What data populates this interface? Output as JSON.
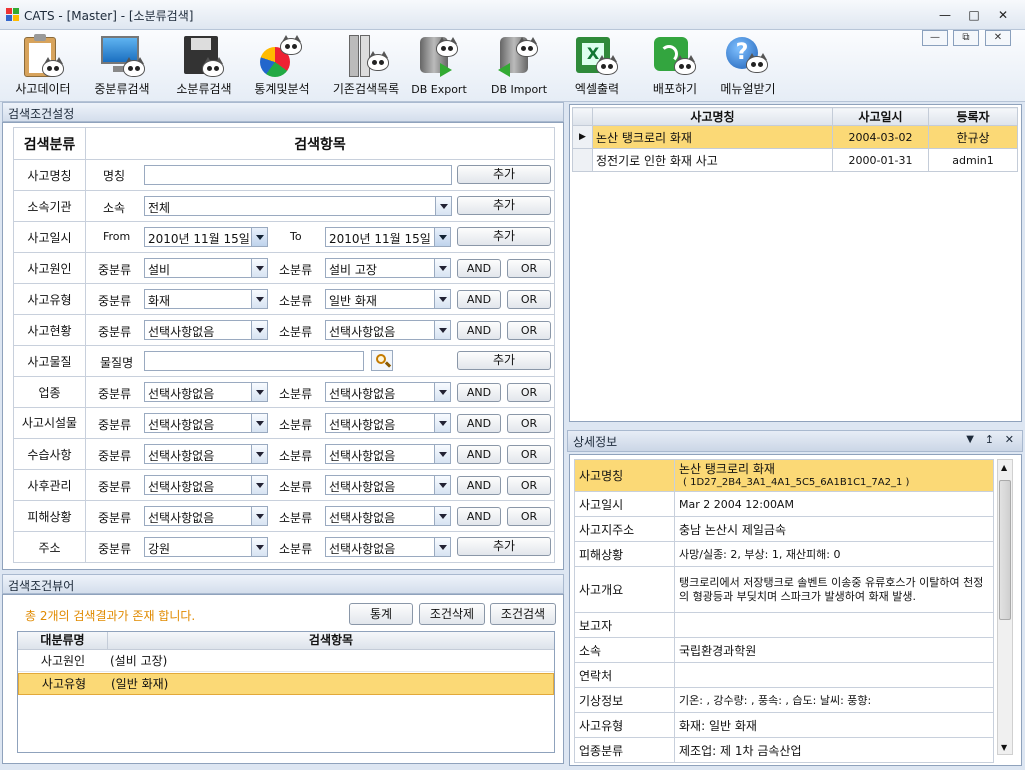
{
  "window": {
    "title": "CATS - [Master] - [소분류검색]"
  },
  "toolbar": [
    {
      "label": "사고데이터",
      "icon": "clipboard-icon"
    },
    {
      "label": "중분류검색",
      "icon": "monitor-icon"
    },
    {
      "label": "소분류검색",
      "icon": "disk-icon"
    },
    {
      "label": "통계및분석",
      "icon": "pie-chart-icon"
    },
    {
      "label": "기존검색목록",
      "icon": "binder-icon"
    },
    {
      "label": "DB Export",
      "icon": "db-export-icon"
    },
    {
      "label": "DB Import",
      "icon": "db-import-icon"
    },
    {
      "label": "엑셀출력",
      "icon": "excel-icon"
    },
    {
      "label": "배포하기",
      "icon": "wireless-icon"
    },
    {
      "label": "메뉴얼받기",
      "icon": "help-icon"
    }
  ],
  "criteria_panel": {
    "title": "검색조건설정",
    "head_category": "검색분류",
    "head_items": "검색항목",
    "rows": {
      "name": {
        "cat": "사고명칭",
        "label": "명칭",
        "value": "",
        "button": "추가"
      },
      "org": {
        "cat": "소속기관",
        "label": "소속",
        "value": "전체",
        "button": "추가"
      },
      "date": {
        "cat": "사고일시",
        "from_label": "From",
        "from": "2010년 11월 15일",
        "to_label": "To",
        "to": "2010년 11월 15일",
        "button": "추가"
      },
      "cause": {
        "cat": "사고원인",
        "mid_label": "중분류",
        "mid": "설비",
        "sub_label": "소분류",
        "sub": "설비 고장"
      },
      "type": {
        "cat": "사고유형",
        "mid_label": "중분류",
        "mid": "화재",
        "sub_label": "소분류",
        "sub": "일반 화재"
      },
      "status": {
        "cat": "사고현황",
        "mid_label": "중분류",
        "mid": "선택사항없음",
        "sub_label": "소분류",
        "sub": "선택사항없음"
      },
      "material": {
        "cat": "사고물질",
        "label": "물질명",
        "value": "",
        "button": "추가"
      },
      "industry": {
        "cat": "업종",
        "mid_label": "중분류",
        "mid": "선택사항없음",
        "sub_label": "소분류",
        "sub": "선택사항없음"
      },
      "facility": {
        "cat": "사고시설물",
        "mid_label": "중분류",
        "mid": "선택사항없음",
        "sub_label": "소분류",
        "sub": "선택사항없음"
      },
      "recovery": {
        "cat": "수습사항",
        "mid_label": "중분류",
        "mid": "선택사항없음",
        "sub_label": "소분류",
        "sub": "선택사항없음"
      },
      "followup": {
        "cat": "사후관리",
        "mid_label": "중분류",
        "mid": "선택사항없음",
        "sub_label": "소분류",
        "sub": "선택사항없음"
      },
      "damage": {
        "cat": "피해상황",
        "mid_label": "중분류",
        "mid": "선택사항없음",
        "sub_label": "소분류",
        "sub": "선택사항없음"
      },
      "address": {
        "cat": "주소",
        "mid_label": "중분류",
        "mid": "강원",
        "sub_label": "소분류",
        "sub": "선택사항없음",
        "button": "추가"
      }
    },
    "and_label": "AND",
    "or_label": "OR"
  },
  "viewer_panel": {
    "title": "검색조건뷰어",
    "result_text": "총 2개의 검색결과가 존재 합니다.",
    "btn_stats": "통계",
    "btn_delete": "조건삭제",
    "btn_search": "조건검색",
    "col_category": "대분류명",
    "col_items": "검색항목",
    "rows": [
      {
        "category": "사고원인",
        "items": "(설비 고장)"
      },
      {
        "category": "사고유형",
        "items": "(일반 화재)"
      }
    ]
  },
  "results": {
    "col_name": "사고명칭",
    "col_date": "사고일시",
    "col_user": "등록자",
    "rows": [
      {
        "name": "논산 탱크로리 화재",
        "date": "2004-03-02",
        "user": "한규상"
      },
      {
        "name": "정전기로 인한 화재 사고",
        "date": "2000-01-31",
        "user": "admin1"
      }
    ]
  },
  "detail": {
    "title": "상세정보",
    "rows": [
      {
        "k": "사고명칭",
        "v": "논산 탱크로리 화재",
        "v2": "( 1D27_2B4_3A1_4A1_5C5_6A1B1C1_7A2_1 )"
      },
      {
        "k": "사고일시",
        "v": "Mar  2 2004 12:00AM"
      },
      {
        "k": "사고지주소",
        "v": "충남 논산시 제일금속"
      },
      {
        "k": "피해상황",
        "v": "사망/실종: 2, 부상: 1, 재산피해: 0"
      },
      {
        "k": "사고개요",
        "v": "탱크로리에서 저장탱크로 솔벤트 이송중 유류호스가 이탈하여 천정의 형광등과 부딪치며 스파크가 발생하여 화재 발생."
      },
      {
        "k": "보고자",
        "v": ""
      },
      {
        "k": "소속",
        "v": "국립환경과학원"
      },
      {
        "k": "연락처",
        "v": ""
      },
      {
        "k": "기상정보",
        "v": "기온: ,  강수량: ,  풍속: ,  습도:    날씨:    풍향:"
      },
      {
        "k": "사고유형",
        "v": "화재: 일반 화재"
      },
      {
        "k": "업종분류",
        "v": "제조업: 제 1차 금속산업"
      }
    ]
  },
  "colors": {
    "highlight": "#fbd976",
    "accent_text": "#e08a00",
    "chrome": "#dde6f2"
  }
}
